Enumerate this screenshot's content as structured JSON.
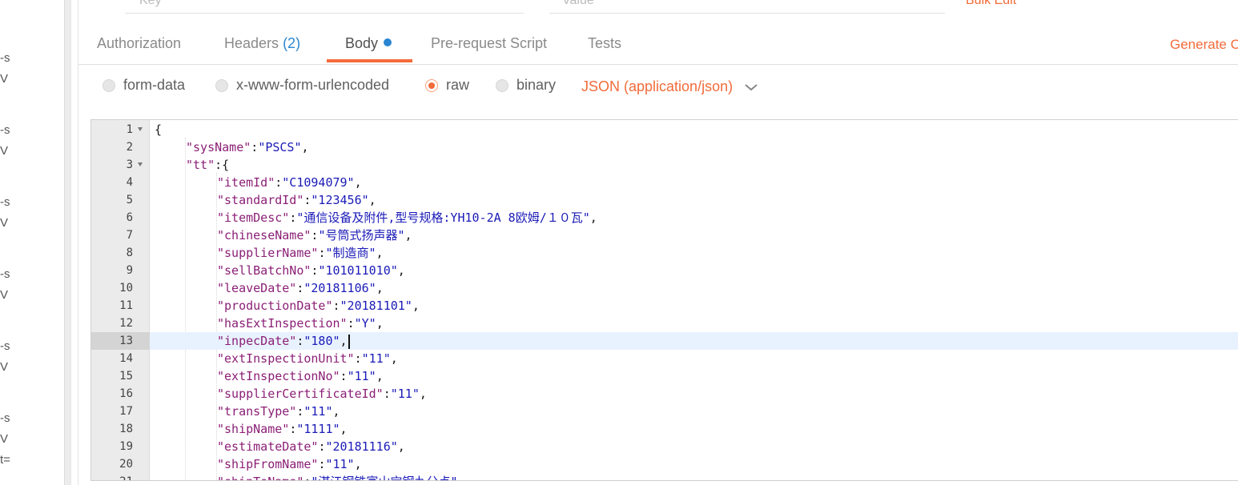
{
  "left_strip": {
    "fragments": [
      "-s",
      "V",
      "-s",
      "V",
      "-s",
      "V",
      "-s",
      "V",
      "-s",
      "V",
      "-s",
      "V",
      "t="
    ]
  },
  "top_row": {
    "key_placeholder": "Key",
    "value_placeholder": "Value",
    "bulk_edit": "Bulk Edit"
  },
  "tabs": [
    {
      "label": "Authorization"
    },
    {
      "label": "Headers",
      "count": "(2)"
    },
    {
      "label": "Body"
    },
    {
      "label": "Pre-request Script"
    },
    {
      "label": "Tests"
    }
  ],
  "generate_code": "Generate Code",
  "body_types": [
    {
      "label": "form-data",
      "selected": false
    },
    {
      "label": "x-www-form-urlencoded",
      "selected": false
    },
    {
      "label": "raw",
      "selected": true
    },
    {
      "label": "binary",
      "selected": false
    }
  ],
  "content_type": "JSON (application/json)",
  "editor": {
    "current_line": 13,
    "lines": [
      {
        "n": "1",
        "indent": 0,
        "fold": true,
        "parts": [
          [
            "punc",
            "{"
          ]
        ]
      },
      {
        "n": "2",
        "indent": 1,
        "parts": [
          [
            "key",
            "\"sysName\""
          ],
          [
            "punc",
            ":"
          ],
          [
            "str",
            "\"PSCS\""
          ],
          [
            "punc",
            ","
          ]
        ]
      },
      {
        "n": "3",
        "indent": 1,
        "fold": true,
        "parts": [
          [
            "key",
            "\"tt\""
          ],
          [
            "punc",
            ":{"
          ]
        ]
      },
      {
        "n": "4",
        "indent": 2,
        "parts": [
          [
            "key",
            "\"itemId\""
          ],
          [
            "punc",
            ":"
          ],
          [
            "str",
            "\"C1094079\""
          ],
          [
            "punc",
            ","
          ]
        ]
      },
      {
        "n": "5",
        "indent": 2,
        "parts": [
          [
            "key",
            "\"standardId\""
          ],
          [
            "punc",
            ":"
          ],
          [
            "str",
            "\"123456\""
          ],
          [
            "punc",
            ","
          ]
        ]
      },
      {
        "n": "6",
        "indent": 2,
        "parts": [
          [
            "key",
            "\"itemDesc\""
          ],
          [
            "punc",
            ":"
          ],
          [
            "str",
            "\"通信设备及附件,型号规格:YH10-2A 8欧姆/１０瓦\""
          ],
          [
            "punc",
            ","
          ]
        ]
      },
      {
        "n": "7",
        "indent": 2,
        "parts": [
          [
            "key",
            "\"chineseName\""
          ],
          [
            "punc",
            ":"
          ],
          [
            "str",
            "\"号筒式扬声器\""
          ],
          [
            "punc",
            ","
          ]
        ]
      },
      {
        "n": "8",
        "indent": 2,
        "parts": [
          [
            "key",
            "\"supplierName\""
          ],
          [
            "punc",
            ":"
          ],
          [
            "str",
            "\"制造商\""
          ],
          [
            "punc",
            ","
          ]
        ]
      },
      {
        "n": "9",
        "indent": 2,
        "parts": [
          [
            "key",
            "\"sellBatchNo\""
          ],
          [
            "punc",
            ":"
          ],
          [
            "str",
            "\"101011010\""
          ],
          [
            "punc",
            ","
          ]
        ]
      },
      {
        "n": "10",
        "indent": 2,
        "parts": [
          [
            "key",
            "\"leaveDate\""
          ],
          [
            "punc",
            ":"
          ],
          [
            "str",
            "\"20181106\""
          ],
          [
            "punc",
            ","
          ]
        ]
      },
      {
        "n": "11",
        "indent": 2,
        "parts": [
          [
            "key",
            "\"productionDate\""
          ],
          [
            "punc",
            ":"
          ],
          [
            "str",
            "\"20181101\""
          ],
          [
            "punc",
            ","
          ]
        ]
      },
      {
        "n": "12",
        "indent": 2,
        "parts": [
          [
            "key",
            "\"hasExtInspection\""
          ],
          [
            "punc",
            ":"
          ],
          [
            "str",
            "\"Y\""
          ],
          [
            "punc",
            ","
          ]
        ]
      },
      {
        "n": "13",
        "indent": 2,
        "parts": [
          [
            "key",
            "\"inpecDate\""
          ],
          [
            "punc",
            ":"
          ],
          [
            "str",
            "\"180\""
          ],
          [
            "punc",
            ","
          ]
        ]
      },
      {
        "n": "14",
        "indent": 2,
        "parts": [
          [
            "key",
            "\"extInspectionUnit\""
          ],
          [
            "punc",
            ":"
          ],
          [
            "str",
            "\"11\""
          ],
          [
            "punc",
            ","
          ]
        ]
      },
      {
        "n": "15",
        "indent": 2,
        "parts": [
          [
            "key",
            "\"extInspectionNo\""
          ],
          [
            "punc",
            ":"
          ],
          [
            "str",
            "\"11\""
          ],
          [
            "punc",
            ","
          ]
        ]
      },
      {
        "n": "16",
        "indent": 2,
        "parts": [
          [
            "key",
            "\"supplierCertificateId\""
          ],
          [
            "punc",
            ":"
          ],
          [
            "str",
            "\"11\""
          ],
          [
            "punc",
            ","
          ]
        ]
      },
      {
        "n": "17",
        "indent": 2,
        "parts": [
          [
            "key",
            "\"transType\""
          ],
          [
            "punc",
            ":"
          ],
          [
            "str",
            "\"11\""
          ],
          [
            "punc",
            ","
          ]
        ]
      },
      {
        "n": "18",
        "indent": 2,
        "parts": [
          [
            "key",
            "\"shipName\""
          ],
          [
            "punc",
            ":"
          ],
          [
            "str",
            "\"1111\""
          ],
          [
            "punc",
            ","
          ]
        ]
      },
      {
        "n": "19",
        "indent": 2,
        "parts": [
          [
            "key",
            "\"estimateDate\""
          ],
          [
            "punc",
            ":"
          ],
          [
            "str",
            "\"20181116\""
          ],
          [
            "punc",
            ","
          ]
        ]
      },
      {
        "n": "20",
        "indent": 2,
        "parts": [
          [
            "key",
            "\"shipFromName\""
          ],
          [
            "punc",
            ":"
          ],
          [
            "str",
            "\"11\""
          ],
          [
            "punc",
            ","
          ]
        ]
      },
      {
        "n": "21",
        "indent": 2,
        "parts": [
          [
            "key",
            "\"shipToName\""
          ],
          [
            "punc",
            ":"
          ],
          [
            "str",
            "\"湛江钢铁富山宝钢九分点\""
          ],
          [
            "punc",
            ","
          ]
        ]
      }
    ]
  },
  "colors": {
    "accent": "#f26b3a",
    "count_blue": "#2a86d1",
    "json_key": "#8b1f76",
    "json_string": "#1a1ab8",
    "current_line_bg": "#e8f2fe"
  }
}
